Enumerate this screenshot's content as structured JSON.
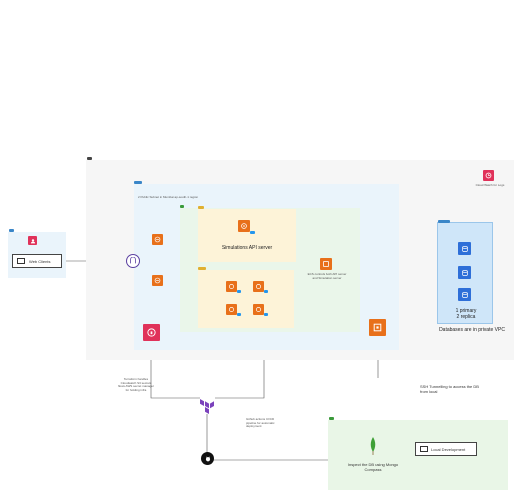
{
  "aws_cloud": {
    "label": "",
    "cloudwatch_label": "Cloud Watch for Logs"
  },
  "public_subnet": {
    "label": "2 Public Subnet in Mumbai ap-south-1 region"
  },
  "private_subnet": {
    "label": ""
  },
  "simulations_group": {
    "label": "Simulations API server"
  },
  "ecs_group": {
    "label": ""
  },
  "ecs_note": {
    "label": "ECS controls both API server and Simulation server"
  },
  "web_clients": {
    "label": "Web Clients"
  },
  "databases": {
    "replica_label": "1 primary\n2 replica",
    "caption": "Databases are in private VPC"
  },
  "terraform_note": {
    "text": "Terraform handles Cloudwatch S3 secrets flows AWS secret manager for holding infra"
  },
  "github_note": {
    "text": "Github actions CI/CD pipeline for automatic deployment"
  },
  "ssh_note": {
    "text": "SSH Tunnelling to access the DB from local"
  },
  "local_dev": {
    "compass_label": "Inspect the DB using Mongo Compass",
    "local_label": "Local Development"
  },
  "colors": {
    "aws_orange": "#e8701a",
    "db_blue": "#2e6fd8",
    "terraform_purple": "#7b42bc",
    "mongo_green": "#3fa037",
    "cloudwatch_pink": "#e0325a"
  }
}
